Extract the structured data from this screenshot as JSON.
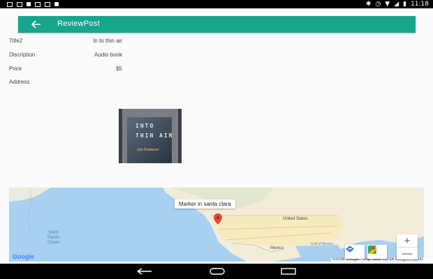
{
  "status_bar": {
    "time": "11:18"
  },
  "toolbar": {
    "title": "ReviewPost",
    "back_icon": "arrow-back-icon",
    "color": "#17a58c"
  },
  "details": [
    {
      "label": "Title2",
      "value": "In to thin air"
    },
    {
      "label": "Discription",
      "value": "Audio book"
    },
    {
      "label": "Price",
      "value": "$5"
    },
    {
      "label": "Address",
      "value": ""
    }
  ],
  "cover": {
    "line1": "INTO",
    "line2": "THIN AIR",
    "author": "Jon Krakauer"
  },
  "map": {
    "info_window": "Marker in santa clara",
    "ocean_label": [
      "North",
      "Pacific",
      "Ocean"
    ],
    "labels": [
      "United States",
      "Mexico",
      "Gulf of Mexico"
    ],
    "google_logo": "Google",
    "copyright": "©2016 Google · Map data ©2016 Google, INEGI",
    "zoom_in": "+",
    "zoom_out": "—"
  },
  "nav": {
    "back_icon": "back-icon",
    "home_icon": "home-icon",
    "recents_icon": "recents-icon"
  }
}
